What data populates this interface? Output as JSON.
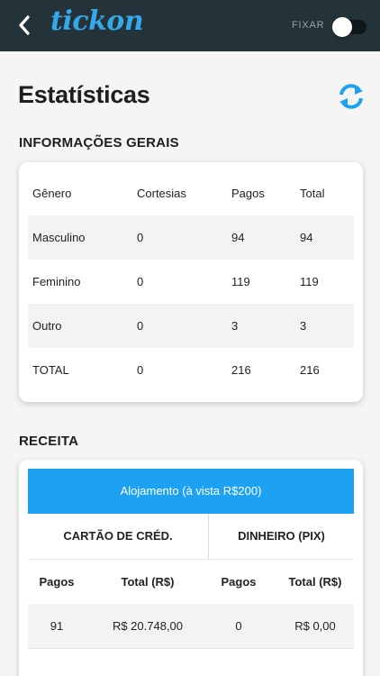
{
  "app": {
    "logo": "tickon",
    "fixar_label": "FIXAR",
    "fixar_on": false
  },
  "page": {
    "title": "Estatísticas"
  },
  "general": {
    "section_title": "INFORMAÇÕES GERAIS",
    "headers": [
      "Gênero",
      "Cortesias",
      "Pagos",
      "Total"
    ],
    "rows": [
      [
        "Masculino",
        "0",
        "94",
        "94"
      ],
      [
        "Feminino",
        "0",
        "119",
        "119"
      ],
      [
        "Outro",
        "0",
        "3",
        "3"
      ],
      [
        "TOTAL",
        "0",
        "216",
        "216"
      ]
    ]
  },
  "revenue": {
    "section_title": "RECEITA",
    "item_label": "Alojamento (à vista R$200)",
    "methods": [
      "CARTÃO DE CRÉD.",
      "DINHEIRO (PIX)"
    ],
    "headers": [
      "Pagos",
      "Total (R$)",
      "Pagos",
      "Total (R$)"
    ],
    "row": [
      "91",
      "R$ 20.748,00",
      "0",
      "R$ 0,00"
    ]
  },
  "colors": {
    "topbar": "#243239",
    "accent": "#1da1f2",
    "logo": "#34a8e8"
  },
  "icons": {
    "back": "chevron-left",
    "refresh": "refresh"
  }
}
